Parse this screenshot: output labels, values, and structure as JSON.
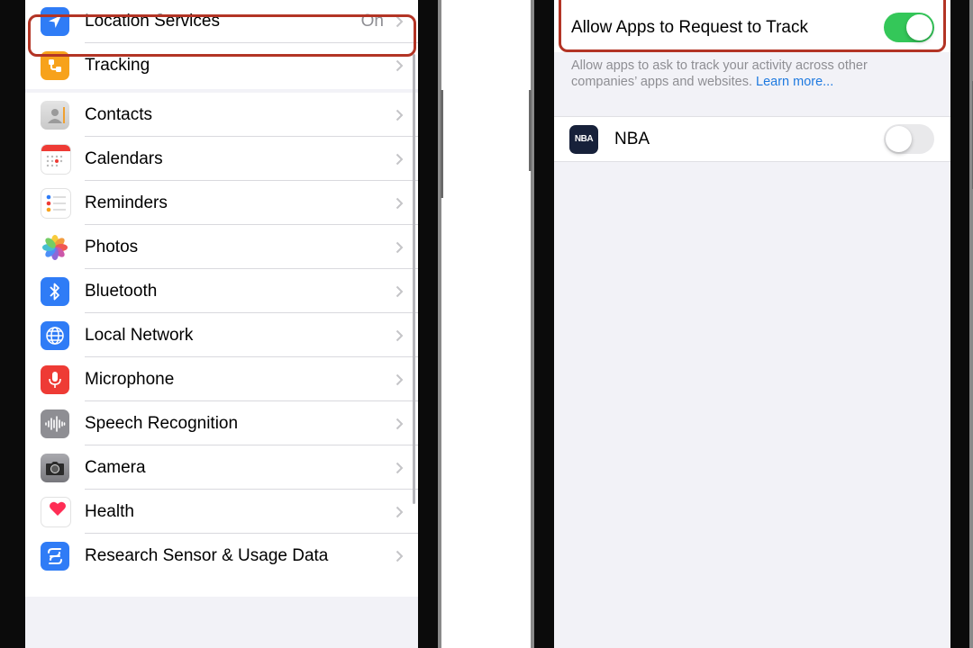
{
  "left_screen": {
    "top_group": [
      {
        "label": "Location Services",
        "value": "On",
        "icon": "location-arrow-icon",
        "color": "#2f7cf6"
      },
      {
        "label": "Tracking",
        "icon": "tracking-icon",
        "color": "#f7a21b"
      }
    ],
    "apps_group": [
      {
        "label": "Contacts",
        "icon": "contacts-icon"
      },
      {
        "label": "Calendars",
        "icon": "calendar-icon"
      },
      {
        "label": "Reminders",
        "icon": "reminders-icon"
      },
      {
        "label": "Photos",
        "icon": "photos-icon"
      },
      {
        "label": "Bluetooth",
        "icon": "bluetooth-icon",
        "color": "#2f7cf6"
      },
      {
        "label": "Local Network",
        "icon": "globe-icon",
        "color": "#2f7cf6"
      },
      {
        "label": "Microphone",
        "icon": "microphone-icon",
        "color": "#ee3b35"
      },
      {
        "label": "Speech Recognition",
        "icon": "waveform-icon",
        "color": "#8e8e93"
      },
      {
        "label": "Camera",
        "icon": "camera-icon",
        "color": "#8e8e93"
      },
      {
        "label": "Health",
        "icon": "heart-icon",
        "color": "#ff2d55"
      },
      {
        "label": "Research Sensor & Usage Data",
        "icon": "research-icon",
        "color": "#2f7cf6"
      }
    ]
  },
  "right_screen": {
    "allow_toggle": {
      "label": "Allow Apps to Request to Track",
      "state": "on"
    },
    "footer_text": "Allow apps to ask to track your activity across other companies’ apps and websites.",
    "footer_link": "Learn more...",
    "apps": [
      {
        "label": "NBA",
        "icon_text": "NBA",
        "state": "off"
      }
    ]
  },
  "colors": {
    "highlight": "#b33425",
    "toggle_on": "#34c759",
    "link": "#1f7ae0"
  }
}
